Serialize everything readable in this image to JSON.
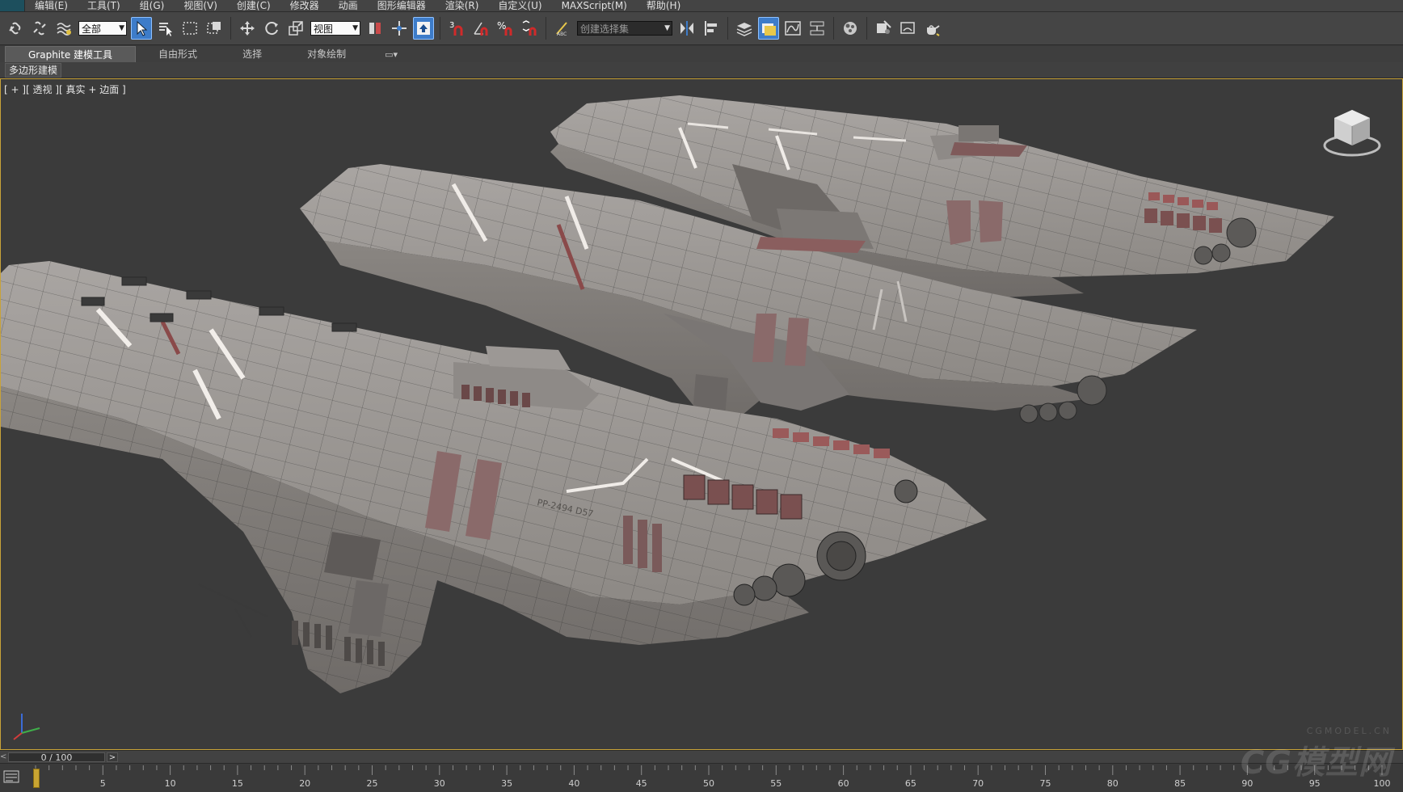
{
  "menubar": {
    "items": [
      "编辑(E)",
      "工具(T)",
      "组(G)",
      "视图(V)",
      "创建(C)",
      "修改器",
      "动画",
      "图形编辑器",
      "渲染(R)",
      "自定义(U)",
      "MAXScript(M)",
      "帮助(H)"
    ]
  },
  "toolbar": {
    "selection_filter": "全部",
    "ref_coord": "视图",
    "snap_label": "3",
    "named_selection": "创建选择集"
  },
  "ribbon": {
    "tabs": [
      "Graphite 建模工具",
      "自由形式",
      "选择",
      "对象绘制"
    ],
    "active_tab": "Graphite 建模工具",
    "subtab": "多边形建模"
  },
  "viewport": {
    "label": "[ + ][ 透视 ][ 真实 + 边面 ]",
    "bg_color": "#3b3b3b",
    "border_color": "#c8a238"
  },
  "time_slider": {
    "value": "0 / 100",
    "next_label": ">",
    "prev_label": "<",
    "current_frame": 0,
    "total_frames": 100
  },
  "trackbar": {
    "ticks": [
      "5",
      "10",
      "15",
      "20",
      "25",
      "30",
      "35",
      "40",
      "45",
      "50",
      "55",
      "60",
      "65",
      "70",
      "75",
      "80",
      "85",
      "90",
      "95",
      "100"
    ]
  },
  "watermark": {
    "big": "CG模型网",
    "small": "CGMODEL.CN"
  },
  "icons": [
    "link-icon",
    "unlink-icon",
    "bind-space-warp-icon",
    "select-icon",
    "select-by-name-icon",
    "rect-region-icon",
    "window-crossing-icon",
    "move-icon",
    "rotate-icon",
    "scale-icon",
    "mirror-icon",
    "align-icon",
    "layer-icon",
    "render-setup-icon",
    "render-frame-icon",
    "teapot-icon"
  ]
}
